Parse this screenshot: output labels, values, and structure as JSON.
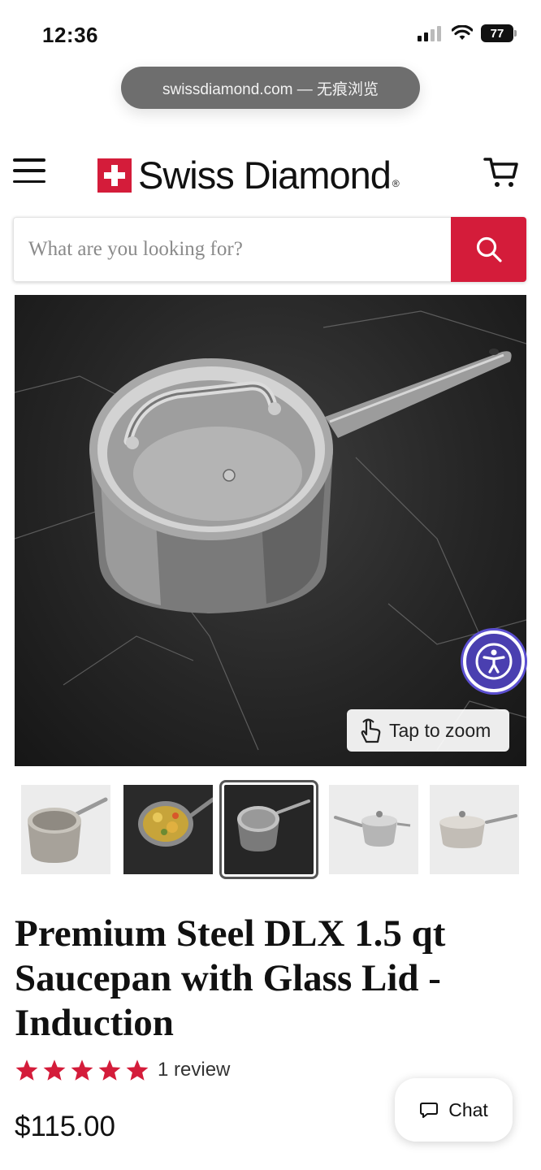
{
  "status_bar": {
    "time": "12:36",
    "battery": "77"
  },
  "browser": {
    "url_label": "swissdiamond.com — 无痕浏览"
  },
  "header": {
    "logo_text": "Swiss Diamond",
    "logo_reg": "®"
  },
  "search": {
    "placeholder": "What are you looking for?"
  },
  "gallery": {
    "zoom_label": "Tap to zoom",
    "selected_index": 2,
    "thumbnail_count": 5
  },
  "product": {
    "title": "Premium Steel DLX 1.5 qt Saucepan with Glass Lid - Induction",
    "rating": 5,
    "review_label": "1 review",
    "price": "$115.00"
  },
  "chat": {
    "label": "Chat"
  },
  "colors": {
    "brand_red": "#d41c3a",
    "accessibility_purple": "#4a3fb0"
  }
}
